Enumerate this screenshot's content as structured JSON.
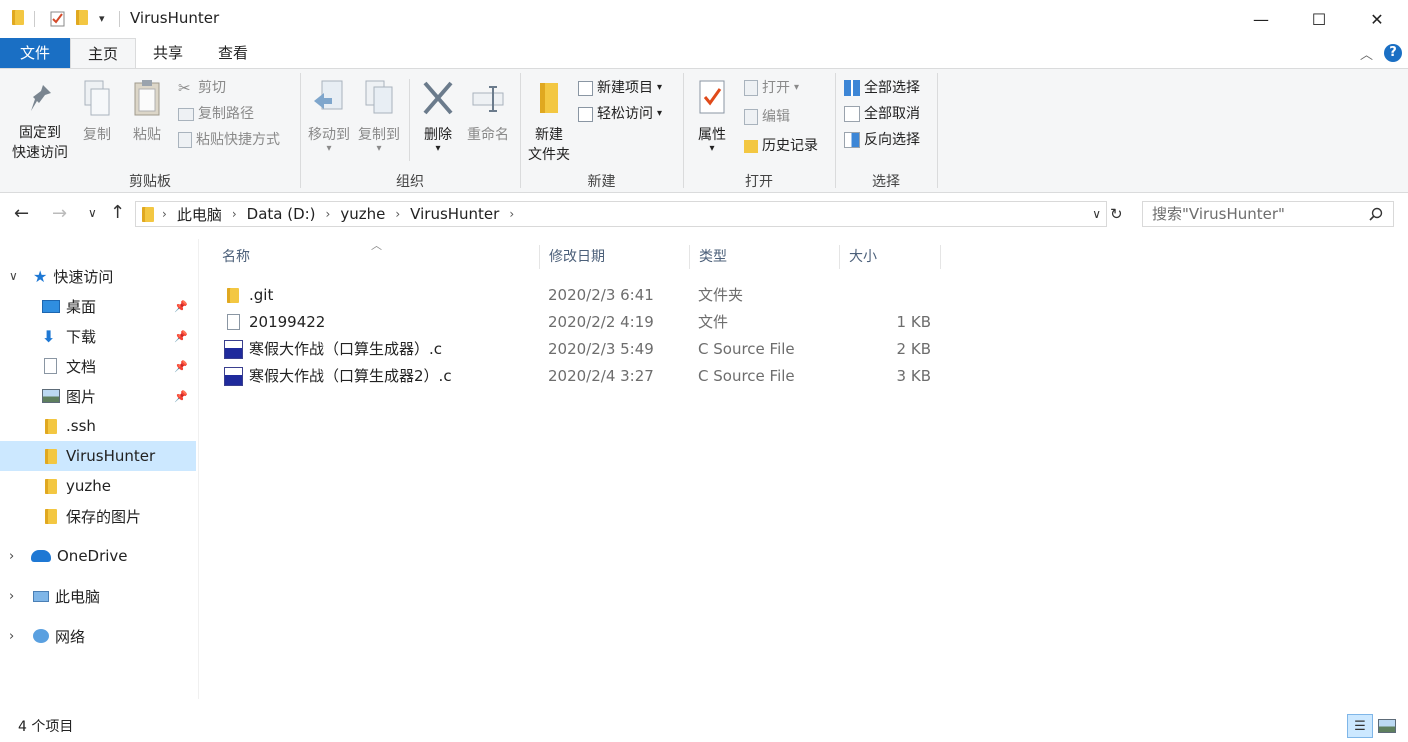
{
  "window": {
    "title": "VirusHunter",
    "controls": {
      "minimize": "—",
      "maximize": "☐",
      "close": "✕"
    }
  },
  "tabs": {
    "file": "文件",
    "home": "主页",
    "share": "共享",
    "view": "查看"
  },
  "ribbon": {
    "clipboard": {
      "label": "剪贴板",
      "pin_line1": "固定到",
      "pin_line2": "快速访问",
      "copy": "复制",
      "paste": "粘贴",
      "cut": "剪切",
      "copy_path": "复制路径",
      "paste_shortcut": "粘贴快捷方式"
    },
    "organize": {
      "label": "组织",
      "move_to": "移动到",
      "copy_to": "复制到",
      "delete": "删除",
      "rename": "重命名"
    },
    "new": {
      "label": "新建",
      "new_folder_line1": "新建",
      "new_folder_line2": "文件夹",
      "new_item": "新建项目",
      "easy_access": "轻松访问"
    },
    "open": {
      "label": "打开",
      "properties": "属性",
      "open": "打开",
      "edit": "编辑",
      "history": "历史记录"
    },
    "select": {
      "label": "选择",
      "select_all": "全部选择",
      "select_none": "全部取消",
      "invert": "反向选择"
    }
  },
  "address": {
    "crumbs": [
      "此电脑",
      "Data (D:)",
      "yuzhe",
      "VirusHunter"
    ],
    "search_placeholder": "搜索\"VirusHunter\""
  },
  "nav": {
    "quick_access": "快速访问",
    "items": [
      {
        "label": "桌面",
        "icon": "desktop-icon",
        "pinned": true
      },
      {
        "label": "下载",
        "icon": "download-icon",
        "pinned": true
      },
      {
        "label": "文档",
        "icon": "documents-icon",
        "pinned": true
      },
      {
        "label": "图片",
        "icon": "pictures-icon",
        "pinned": true
      },
      {
        "label": ".ssh",
        "icon": "folder-icon",
        "pinned": false
      },
      {
        "label": "VirusHunter",
        "icon": "folder-icon",
        "pinned": false
      },
      {
        "label": "yuzhe",
        "icon": "folder-icon",
        "pinned": false
      },
      {
        "label": "保存的图片",
        "icon": "folder-icon",
        "pinned": false
      }
    ],
    "onedrive": "OneDrive",
    "this_pc": "此电脑",
    "network": "网络"
  },
  "columns": {
    "name": "名称",
    "modified": "修改日期",
    "type": "类型",
    "size": "大小"
  },
  "files": [
    {
      "name": ".git",
      "modified": "2020/2/3 6:41",
      "type": "文件夹",
      "size": "",
      "icon": "folder-icon"
    },
    {
      "name": "20199422",
      "modified": "2020/2/2 4:19",
      "type": "文件",
      "size": "1 KB",
      "icon": "file-icon"
    },
    {
      "name": "寒假大作战（口算生成器）.c",
      "modified": "2020/2/3 5:49",
      "type": "C Source File",
      "size": "2 KB",
      "icon": "c-source-icon"
    },
    {
      "name": "寒假大作战（口算生成器2）.c",
      "modified": "2020/2/4 3:27",
      "type": "C Source File",
      "size": "3 KB",
      "icon": "c-source-icon"
    }
  ],
  "status": {
    "count": "4 个项目"
  },
  "colors": {
    "accent": "#1a6fc4",
    "selection": "#cce8ff",
    "folder": "#f3c742"
  }
}
